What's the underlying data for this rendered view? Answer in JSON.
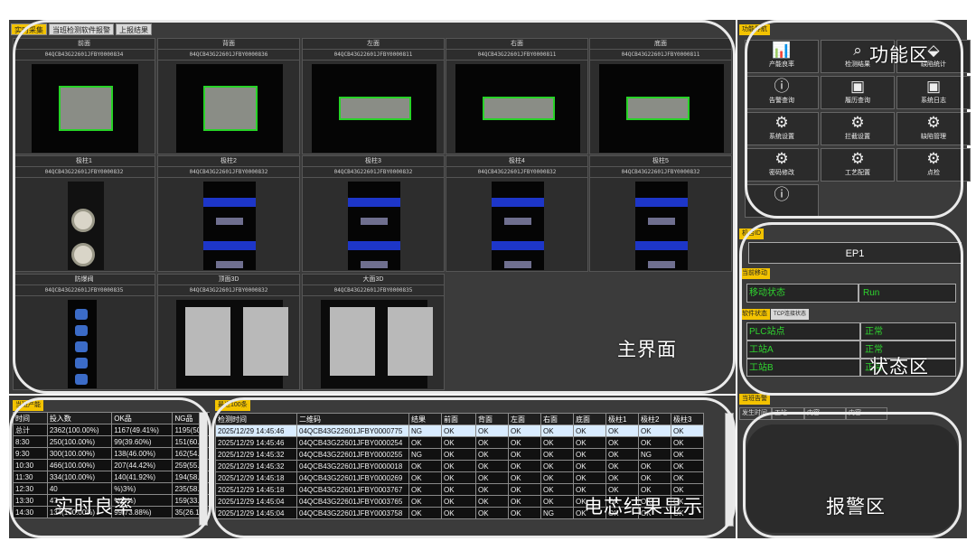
{
  "tabs": [
    "实时采集",
    "当班检测软件报警",
    "上报结果"
  ],
  "views": [
    {
      "title": "前面",
      "code": "04QCB43G22601JFBY0000834"
    },
    {
      "title": "背面",
      "code": "04QCB43G22601JFBY0000836"
    },
    {
      "title": "左面",
      "code": "04QCB43G22601JFBY0000811"
    },
    {
      "title": "右面",
      "code": "04QCB43G22601JFBY0000811"
    },
    {
      "title": "底面",
      "code": "04QCB43G22601JFBY0000811"
    },
    {
      "title": "极柱1",
      "code": "04QCB43G22601JFBY0000832"
    },
    {
      "title": "极柱2",
      "code": "04QCB43G22601JFBY0000832"
    },
    {
      "title": "极柱3",
      "code": "04QCB43G22601JFBY0000832"
    },
    {
      "title": "极柱4",
      "code": "04QCB43G22601JFBY0000832"
    },
    {
      "title": "极柱5",
      "code": "04QCB43G22601JFBY0000832"
    },
    {
      "title": "防爆阀",
      "code": "04QCB43G22601JFBY0000835"
    },
    {
      "title": "顶面3D",
      "code": "04QCB43G22601JFBY0000832"
    },
    {
      "title": "大面3D",
      "code": "04QCB43G22601JFBY0000835"
    }
  ],
  "overlay_labels": {
    "main": "主界面",
    "function": "功能区",
    "status": "状态区",
    "yield": "实时良率",
    "result": "电芯结果显示",
    "alarm": "报警区"
  },
  "function_panel": {
    "title": "功能导航",
    "buttons": [
      {
        "label": "产能良率",
        "icon": "bar-chart-icon",
        "glyph": "📊"
      },
      {
        "label": "检测结果",
        "icon": "search-icon",
        "glyph": "⌕"
      },
      {
        "label": "缺陷统计",
        "icon": "tag-icon",
        "glyph": "⬙"
      },
      {
        "label": "告警查询",
        "icon": "info-icon",
        "glyph": "ⓘ"
      },
      {
        "label": "履历查询",
        "icon": "calendar-icon",
        "glyph": "▣"
      },
      {
        "label": "系统日志",
        "icon": "calendar-icon",
        "glyph": "▣"
      },
      {
        "label": "系统设置",
        "icon": "gear-icon",
        "glyph": "⚙"
      },
      {
        "label": "拦截设置",
        "icon": "gear-icon",
        "glyph": "⚙"
      },
      {
        "label": "缺陷管理",
        "icon": "gear-icon",
        "glyph": "⚙"
      },
      {
        "label": "密码修改",
        "icon": "gear-icon",
        "glyph": "⚙"
      },
      {
        "label": "工艺配置",
        "icon": "gear-icon",
        "glyph": "⚙"
      },
      {
        "label": "点检",
        "icon": "gear-icon",
        "glyph": "⚙"
      },
      {
        "label": "",
        "icon": "info-icon",
        "glyph": "ⓘ"
      }
    ]
  },
  "machine": {
    "title": "机台ID",
    "value": "EP1"
  },
  "move": {
    "title": "当前移动",
    "label": "移动状态",
    "value": "Run"
  },
  "status": {
    "tabs": [
      "软件状态",
      "TCP连接状态"
    ],
    "rows": [
      {
        "name": "PLC站点",
        "value": "正常"
      },
      {
        "name": "工站A",
        "value": "正常"
      },
      {
        "name": "工站B",
        "value": "正常"
      }
    ]
  },
  "alarm": {
    "title": "当班告警",
    "headers": [
      "发生时间",
      "工站",
      "内容",
      "内容"
    ]
  },
  "yield": {
    "title": "当班产能",
    "headers": [
      "时间",
      "投入数",
      "OK品",
      "NG品"
    ],
    "rows": [
      [
        "总计",
        "2362(100.00%)",
        "1167(49.41%)",
        "1195(50."
      ],
      [
        "8:30",
        "250(100.00%)",
        "99(39.60%)",
        "151(60.4"
      ],
      [
        "9:30",
        "300(100.00%)",
        "138(46.00%)",
        "162(54.0"
      ],
      [
        "10:30",
        "466(100.00%)",
        "207(44.42%)",
        "259(55.5"
      ],
      [
        "11:30",
        "334(100.00%)",
        "140(41.92%)",
        "194(58.0"
      ],
      [
        "12:30",
        "40",
        "%)3%)",
        "235(58.1"
      ],
      [
        "13:30",
        "47",
        "%)6%)",
        "159(33.5"
      ],
      [
        "14:30",
        "134(100.00%)",
        "99(73.88%)",
        "35(26.12"
      ]
    ]
  },
  "results": {
    "title": "最近100条",
    "headers": [
      "检测时间",
      "二维码",
      "结果",
      "前面",
      "背面",
      "左面",
      "右面",
      "底面",
      "极柱1",
      "极柱2",
      "极柱3"
    ],
    "rows": [
      [
        "2025/12/29 14:45:46",
        "04QCB43G22601JFBY0000775",
        "NG",
        "OK",
        "OK",
        "OK",
        "OK",
        "OK",
        "OK",
        "OK",
        "OK"
      ],
      [
        "2025/12/29 14:45:46",
        "04QCB43G22601JFBY0000254",
        "OK",
        "OK",
        "OK",
        "OK",
        "OK",
        "OK",
        "OK",
        "OK",
        "OK"
      ],
      [
        "2025/12/29 14:45:32",
        "04QCB43G22601JFBY0000255",
        "NG",
        "OK",
        "OK",
        "OK",
        "OK",
        "OK",
        "OK",
        "NG",
        "OK"
      ],
      [
        "2025/12/29 14:45:32",
        "04QCB43G22601JFBY0000018",
        "OK",
        "OK",
        "OK",
        "OK",
        "OK",
        "OK",
        "OK",
        "OK",
        "OK"
      ],
      [
        "2025/12/29 14:45:18",
        "04QCB43G22601JFBY0000269",
        "OK",
        "OK",
        "OK",
        "OK",
        "OK",
        "OK",
        "OK",
        "OK",
        "OK"
      ],
      [
        "2025/12/29 14:45:18",
        "04QCB43G22601JFBY0003767",
        "OK",
        "OK",
        "OK",
        "OK",
        "OK",
        "OK",
        "OK",
        "OK",
        "OK"
      ],
      [
        "2025/12/29 14:45:04",
        "04QCB43G22601JFBY0003765",
        "OK",
        "OK",
        "OK",
        "OK",
        "OK",
        "OK",
        "OK",
        "OK",
        "OK"
      ],
      [
        "2025/12/29 14:45:04",
        "04QCB43G22601JFBY0003758",
        "OK",
        "OK",
        "OK",
        "OK",
        "NG",
        "OK",
        "OK",
        "OK",
        "OK"
      ]
    ]
  }
}
